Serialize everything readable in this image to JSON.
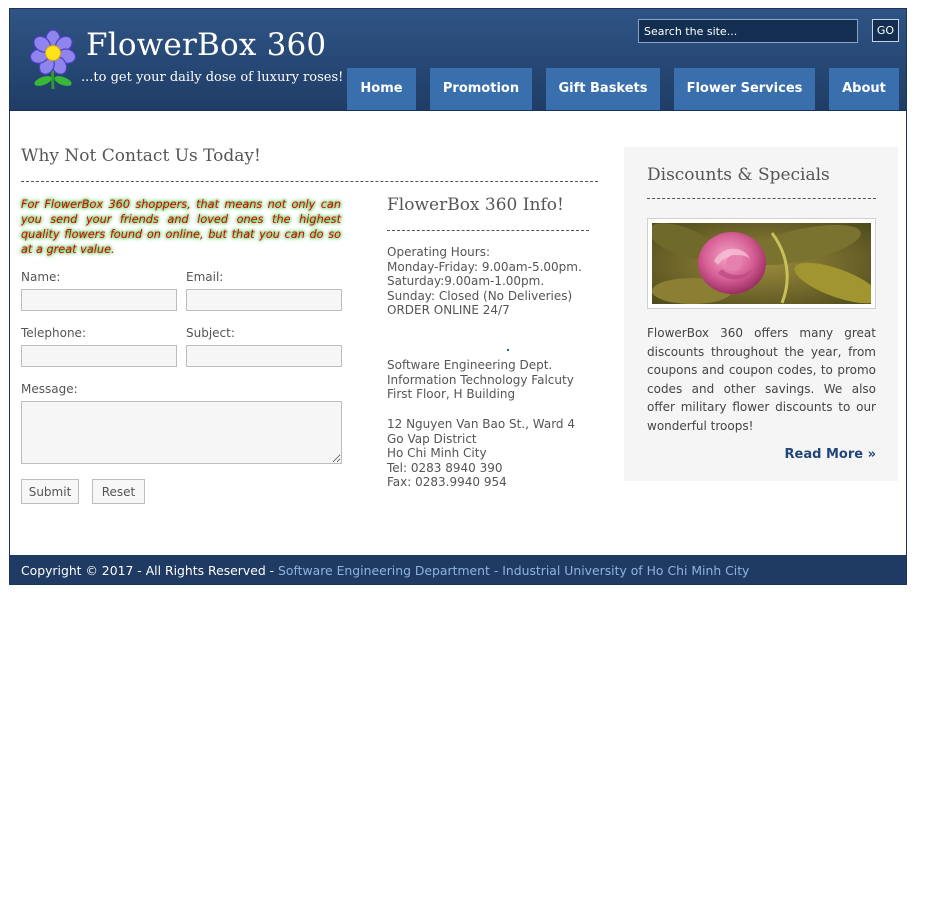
{
  "header": {
    "site_title": "FlowerBox 360",
    "tagline": "...to get your daily dose of luxury roses!",
    "logo_icon": "flower-icon",
    "search_placeholder": "Search the site...",
    "go_label": "GO",
    "nav": [
      {
        "label": "Home"
      },
      {
        "label": "Promotion"
      },
      {
        "label": "Gift Baskets"
      },
      {
        "label": "Flower Services"
      },
      {
        "label": "About"
      }
    ]
  },
  "contact": {
    "title": "Why Not Contact Us Today!",
    "intro": "For FlowerBox 360 shoppers, that means not only can you send your friends and loved ones the highest quality flowers found on online, but that you can do so at a great value.",
    "labels": {
      "name": "Name:",
      "email": "Email:",
      "telephone": "Telephone:",
      "subject": "Subject:",
      "message": "Message:"
    },
    "submit_label": "Submit",
    "reset_label": "Reset"
  },
  "info": {
    "title": "FlowerBox 360 Info!",
    "hours": [
      "Operating Hours:",
      "Monday-Friday: 9.00am-5.00pm.",
      "Saturday:9.00am-1.00pm.",
      "Sunday: Closed (No Deliveries)",
      "ORDER ONLINE 24/7"
    ],
    "department": [
      "Software Engineering Dept.",
      "Information Technology Falcuty",
      "First Floor, H Building"
    ],
    "address": [
      "12 Nguyen Van Bao St., Ward 4",
      "Go Vap District",
      "Ho Chi Minh City",
      "Tel: 0283 8940 390",
      "Fax: 0283.9940 954"
    ]
  },
  "sidebar": {
    "title": "Discounts & Specials",
    "text": "FlowerBox 360 offers many great discounts throughout the year, from coupons and coupon codes, to promo codes and other savings. We also offer military flower discounts to our wonderful troops!",
    "read_more": "Read More »"
  },
  "footer": {
    "copyright": "Copyright © 2017 - All Rights Reserved - ",
    "link1": "Software Engineering Department",
    "separator": " - ",
    "link2": "Industrial University of Ho Chi Minh City"
  }
}
